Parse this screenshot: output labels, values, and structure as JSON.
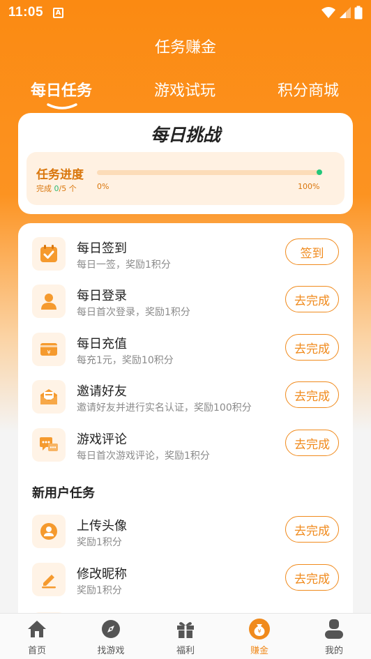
{
  "status_bar": {
    "time": "11:05",
    "notification": "A"
  },
  "header": {
    "title": "任务赚金"
  },
  "tabs": [
    {
      "label": "每日任务",
      "active": true
    },
    {
      "label": "游戏试玩",
      "active": false
    },
    {
      "label": "积分商城",
      "active": false
    }
  ],
  "challenge": {
    "title": "每日挑战",
    "progress_label": "任务进度",
    "completed_prefix": "完成 ",
    "completed": "0",
    "total": "/5 个",
    "min_label": "0%",
    "max_label": "100%",
    "progress": 0
  },
  "daily_tasks": [
    {
      "icon": "calendar-check-icon",
      "name": "每日签到",
      "desc": "每日一签，奖励1积分",
      "button": "签到"
    },
    {
      "icon": "user-icon",
      "name": "每日登录",
      "desc": "每日首次登录，奖励1积分",
      "button": "去完成"
    },
    {
      "icon": "wallet-icon",
      "name": "每日充值",
      "desc": "每充1元，奖励10积分",
      "button": "去完成"
    },
    {
      "icon": "envelope-icon",
      "name": "邀请好友",
      "desc": "邀请好友并进行实名认证，奖励100积分",
      "button": "去完成"
    },
    {
      "icon": "chat-icon",
      "name": "游戏评论",
      "desc": "每日首次游戏评论，奖励1积分",
      "button": "去完成"
    }
  ],
  "new_user_section": {
    "title": "新用户任务"
  },
  "new_user_tasks": [
    {
      "icon": "avatar-icon",
      "name": "上传头像",
      "desc": "奖励1积分",
      "button": "去完成"
    },
    {
      "icon": "pencil-icon",
      "name": "修改昵称",
      "desc": "奖励1积分",
      "button": "去完成"
    }
  ],
  "bottom_nav": [
    {
      "icon": "home-icon",
      "label": "首页",
      "active": false
    },
    {
      "icon": "compass-icon",
      "label": "找游戏",
      "active": false
    },
    {
      "icon": "gift-icon",
      "label": "福利",
      "active": false
    },
    {
      "icon": "money-bag-icon",
      "label": "赚金",
      "active": true
    },
    {
      "icon": "profile-icon",
      "label": "我的",
      "active": false
    }
  ],
  "colors": {
    "accent": "#f08a1c",
    "header": "#fb8a12",
    "success": "#22c77a"
  }
}
